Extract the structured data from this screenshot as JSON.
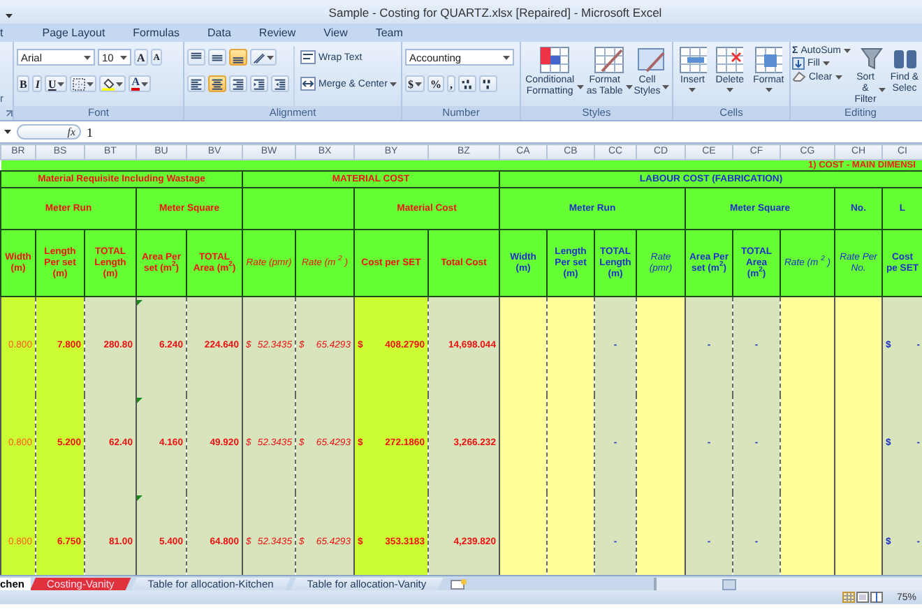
{
  "window": {
    "title": "Sample - Costing for QUARTZ.xlsx [Repaired] - Microsoft Excel"
  },
  "ribbon_tabs": [
    {
      "label": "t",
      "selected": false
    },
    {
      "label": "Page Layout",
      "selected": false
    },
    {
      "label": "Formulas",
      "selected": false
    },
    {
      "label": "Data",
      "selected": false
    },
    {
      "label": "Review",
      "selected": false
    },
    {
      "label": "View",
      "selected": false
    },
    {
      "label": "Team",
      "selected": false
    }
  ],
  "ribbon": {
    "clipboard": {
      "label_fragment": "r"
    },
    "font": {
      "name": "Arial",
      "size": "10",
      "grow": "A",
      "shrink": "A",
      "bold": "B",
      "italic": "I",
      "underline": "U",
      "font_color": "A",
      "label": "Font"
    },
    "alignment": {
      "valign_buttons": [
        {
          "selected": false
        },
        {
          "selected": false
        },
        {
          "selected": true
        }
      ],
      "halign_buttons": [
        {
          "selected": false
        },
        {
          "selected": true
        },
        {
          "selected": false
        }
      ],
      "wrap": "Wrap Text",
      "merge": "Merge & Center",
      "label": "Alignment"
    },
    "number": {
      "format": "Accounting",
      "currency": "$",
      "percent": "%",
      "comma": ",",
      "label": "Number"
    },
    "styles": {
      "buttons": [
        "Conditional Formatting",
        "Format as Table",
        "Cell Styles"
      ],
      "label": "Styles"
    },
    "cells": {
      "buttons": [
        "Insert",
        "Delete",
        "Format"
      ],
      "label": "Cells"
    },
    "editing": {
      "sum_symbol": "Σ",
      "autosum": "AutoSum",
      "fill": "Fill",
      "clear": "Clear",
      "buttons": [
        "Sort & Filter",
        "Find & Selec"
      ],
      "label": "Editing"
    }
  },
  "formula_bar": {
    "fx": "fx",
    "content": "1"
  },
  "sheet": {
    "banner": "1) COST - MAIN DIMENSI",
    "sections": [
      {
        "label": "Material Requisite Including Wastage",
        "kind": "material",
        "groups": [
          {
            "label": "Meter Run",
            "columns": [
              {
                "letter": "BR",
                "label": "Width (m)",
                "kind": "input"
              },
              {
                "letter": "BS",
                "label": "Length Per set (m)",
                "kind": "input"
              },
              {
                "letter": "BT",
                "label": "TOTAL Length (m)",
                "kind": "formula"
              }
            ]
          },
          {
            "label": "Meter Square",
            "columns": [
              {
                "letter": "BU",
                "label": "Area Per set  (m$^{2}$)",
                "kind": "formula"
              },
              {
                "letter": "BV",
                "label": "TOTAL Area (m$^{2}$)",
                "kind": "formula"
              }
            ]
          }
        ]
      },
      {
        "label": "MATERIAL COST",
        "kind": "material",
        "groups": [
          {
            "columns": [
              {
                "letter": "BW",
                "label": "Rate (pmr)",
                "kind": "formula"
              },
              {
                "letter": "BX",
                "label": "Rate (m $^{2}$ )",
                "kind": "formula"
              }
            ]
          },
          {
            "label": "Material Cost",
            "columns": [
              {
                "letter": "BY",
                "label": "Cost per SET",
                "kind": "input"
              },
              {
                "letter": "BZ",
                "label": "Total Cost",
                "kind": "formula"
              }
            ]
          }
        ]
      },
      {
        "label": "LABOUR COST  (FABRICATION)",
        "kind": "labour",
        "groups": [
          {
            "label": "Meter Run",
            "columns": [
              {
                "letter": "CA",
                "label": "Width (m)",
                "kind": "entry"
              },
              {
                "letter": "CB",
                "label": "Length Per set (m)",
                "kind": "entry"
              },
              {
                "letter": "CC",
                "label": "TOTAL Length (m)",
                "kind": "formula"
              },
              {
                "letter": "CD",
                "label": "Rate (pmr)",
                "kind": "entry"
              }
            ]
          },
          {
            "label": "Meter Square",
            "columns": [
              {
                "letter": "CE",
                "label": "Area Per set  (m$^{2}$)",
                "kind": "formula"
              },
              {
                "letter": "CF",
                "label": "TOTAL Area (m$^{2}$)",
                "kind": "formula"
              },
              {
                "letter": "CG",
                "label": "Rate (m $^{2}$ )",
                "kind": "entry"
              }
            ]
          },
          {
            "label": "No.",
            "columns": [
              {
                "letter": "CH",
                "label": "Rate Per No.",
                "kind": "entry"
              }
            ]
          },
          {
            "label": "L",
            "columns": [
              {
                "letter": "CI",
                "label": "Cost pe SET",
                "kind": "formula"
              }
            ]
          }
        ]
      }
    ],
    "rows": [
      [
        "0.800",
        "7.800",
        "280.80",
        {
          "value": "6.240",
          "comment": true
        },
        "224.640",
        {
          "symbol": "$",
          "value": "52.3435"
        },
        {
          "symbol": "$",
          "value": "65.4293"
        },
        {
          "symbol": "$",
          "value": "408.2790"
        },
        "14,698.044",
        null,
        null,
        "-",
        null,
        "-",
        "-",
        null,
        null,
        {
          "symbol": "$",
          "value": "-"
        }
      ],
      [
        "0.800",
        "5.200",
        "62.40",
        {
          "value": "4.160",
          "comment": true
        },
        "49.920",
        {
          "symbol": "$",
          "value": "52.3435"
        },
        {
          "symbol": "$",
          "value": "65.4293"
        },
        {
          "symbol": "$",
          "value": "272.1860"
        },
        "3,266.232",
        null,
        null,
        "-",
        null,
        "-",
        "-",
        null,
        null,
        {
          "symbol": "$",
          "value": "-"
        }
      ],
      [
        "0.800",
        "6.750",
        "81.00",
        {
          "value": "5.400",
          "comment": true
        },
        "64.800",
        {
          "symbol": "$",
          "value": "52.3435"
        },
        {
          "symbol": "$",
          "value": "65.4293"
        },
        {
          "symbol": "$",
          "value": "353.3183"
        },
        "4,239.820",
        null,
        null,
        "-",
        null,
        "-",
        "-",
        null,
        null,
        {
          "symbol": "$",
          "value": "-"
        }
      ]
    ]
  },
  "sheet_tabs": [
    {
      "label": "chen",
      "selected": true
    },
    {
      "label": "Costing-Vanity",
      "selected": false,
      "color": "#e0323c"
    },
    {
      "label": "Table for allocation-Kitchen",
      "selected": false
    },
    {
      "label": "Table for allocation-Vanity",
      "selected": false
    }
  ],
  "status_bar": {
    "zoom": "75%"
  }
}
